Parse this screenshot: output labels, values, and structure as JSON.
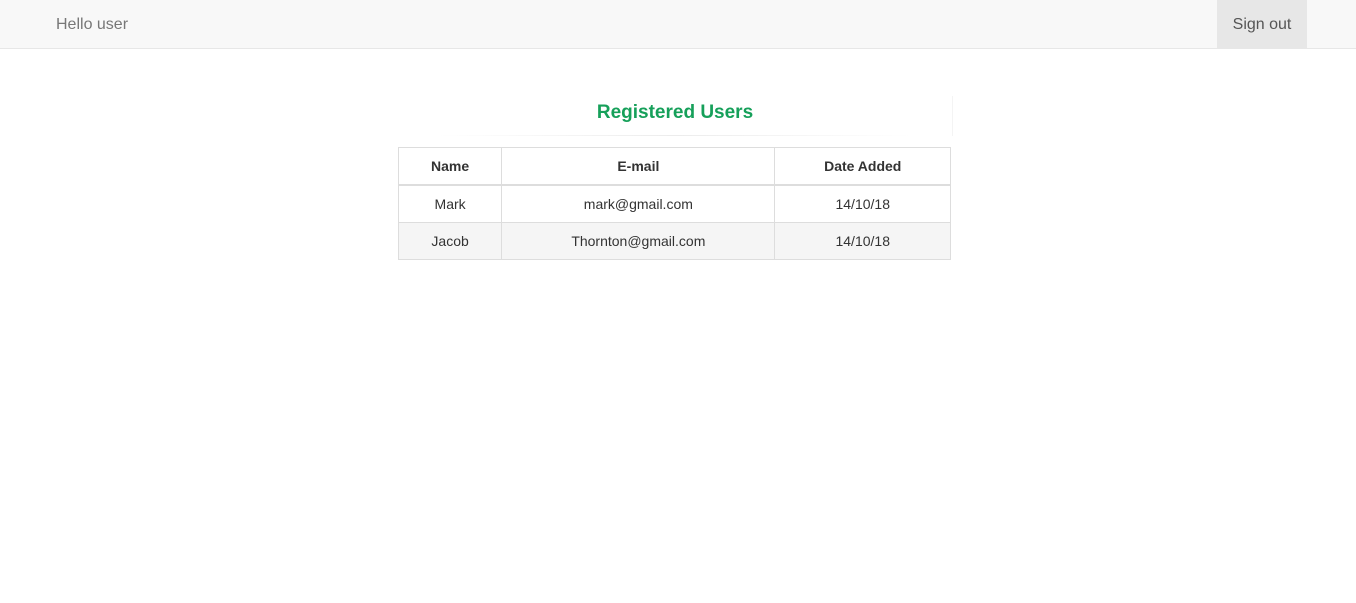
{
  "navbar": {
    "greeting": "Hello user",
    "signout_label": "Sign out"
  },
  "panel": {
    "title": "Registered Users"
  },
  "table": {
    "headers": [
      "Name",
      "E-mail",
      "Date Added"
    ],
    "rows": [
      [
        "Mark",
        "mark@gmail.com",
        "14/10/18"
      ],
      [
        "Jacob",
        "Thornton@gmail.com",
        "14/10/18"
      ]
    ]
  },
  "colors": {
    "title": "#16a05a",
    "navbar_bg": "#f8f8f8",
    "signout_bg": "#e7e7e7",
    "stripe_bg": "#f5f5f5",
    "border": "#dddddd"
  }
}
